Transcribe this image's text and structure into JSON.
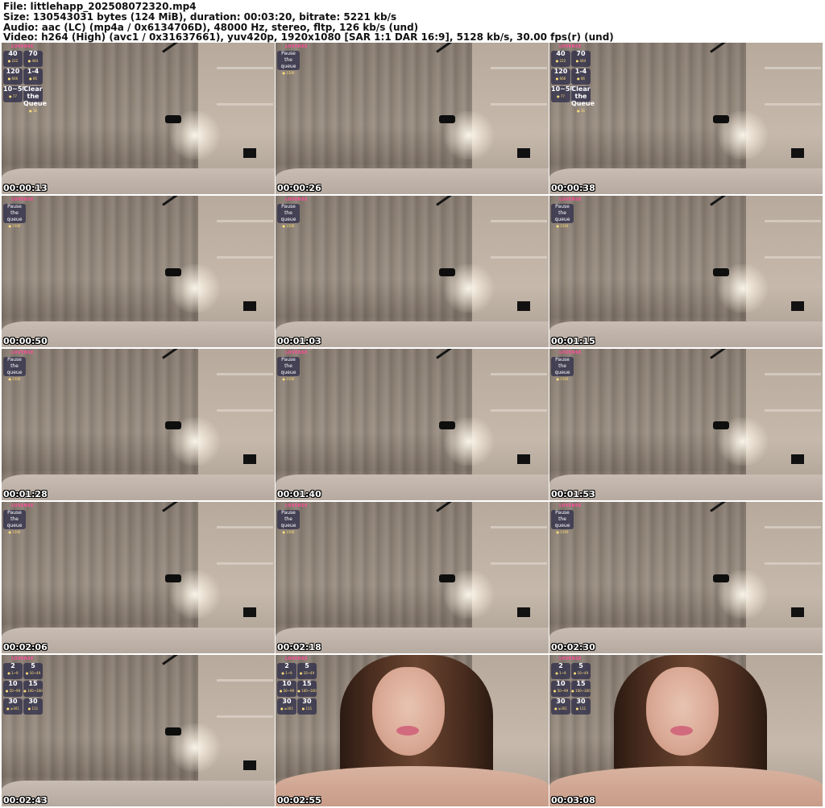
{
  "header": {
    "file": "File: littlehapp_202508072320.mp4",
    "size": "Size: 130543031 bytes (124 MiB), duration: 00:03:20, bitrate: 5221 kb/s",
    "audio": "Audio: aac (LC) (mp4a / 0x6134706D), 48000 Hz, stereo, fltp, 126 kb/s (und)",
    "video": "Video: h264 (High) (avc1 / 0x31637661), yuv420p, 1920x1080 [SAR 1:1 DAR 16:9], 5128 kb/s, 30.00 fps(r) (und)"
  },
  "overlay_brand": "LOVENSE",
  "overlay_tip_cards_frame1": [
    {
      "value": "40",
      "tokens": "222"
    },
    {
      "value": "70",
      "tokens": "444"
    },
    {
      "value": "120",
      "tokens": "666"
    },
    {
      "value": "1-4",
      "tokens": "66"
    },
    {
      "value": "10~50",
      "tokens": "77"
    },
    {
      "value": "Clear the Queue",
      "tokens": "16"
    }
  ],
  "overlay_pause": {
    "label": "Pause the queue",
    "tokens": "1500"
  },
  "overlay_tip_cards_late": [
    {
      "value": "2",
      "tokens": "1~9"
    },
    {
      "value": "5",
      "tokens": "10~49"
    },
    {
      "value": "10",
      "tokens": "50~99"
    },
    {
      "value": "15",
      "tokens": "100~300"
    },
    {
      "value": "30",
      "tokens": "≥301"
    },
    {
      "value": "30",
      "tokens": "111"
    }
  ],
  "thumbnails": [
    {
      "time": "00:00:13",
      "scene": "room",
      "overlay": "cards1"
    },
    {
      "time": "00:00:26",
      "scene": "room",
      "overlay": "pause"
    },
    {
      "time": "00:00:38",
      "scene": "room",
      "overlay": "cards1"
    },
    {
      "time": "00:00:50",
      "scene": "room",
      "overlay": "pause"
    },
    {
      "time": "00:01:03",
      "scene": "room",
      "overlay": "pause"
    },
    {
      "time": "00:01:15",
      "scene": "room",
      "overlay": "pause"
    },
    {
      "time": "00:01:28",
      "scene": "room",
      "overlay": "pause"
    },
    {
      "time": "00:01:40",
      "scene": "room",
      "overlay": "pause"
    },
    {
      "time": "00:01:53",
      "scene": "room",
      "overlay": "pause"
    },
    {
      "time": "00:02:06",
      "scene": "room",
      "overlay": "pause"
    },
    {
      "time": "00:02:18",
      "scene": "room",
      "overlay": "pause"
    },
    {
      "time": "00:02:30",
      "scene": "room",
      "overlay": "pause"
    },
    {
      "time": "00:02:43",
      "scene": "room",
      "overlay": "cards2"
    },
    {
      "time": "00:02:55",
      "scene": "person",
      "overlay": "cards2"
    },
    {
      "time": "00:03:08",
      "scene": "person",
      "overlay": "cards2"
    }
  ]
}
